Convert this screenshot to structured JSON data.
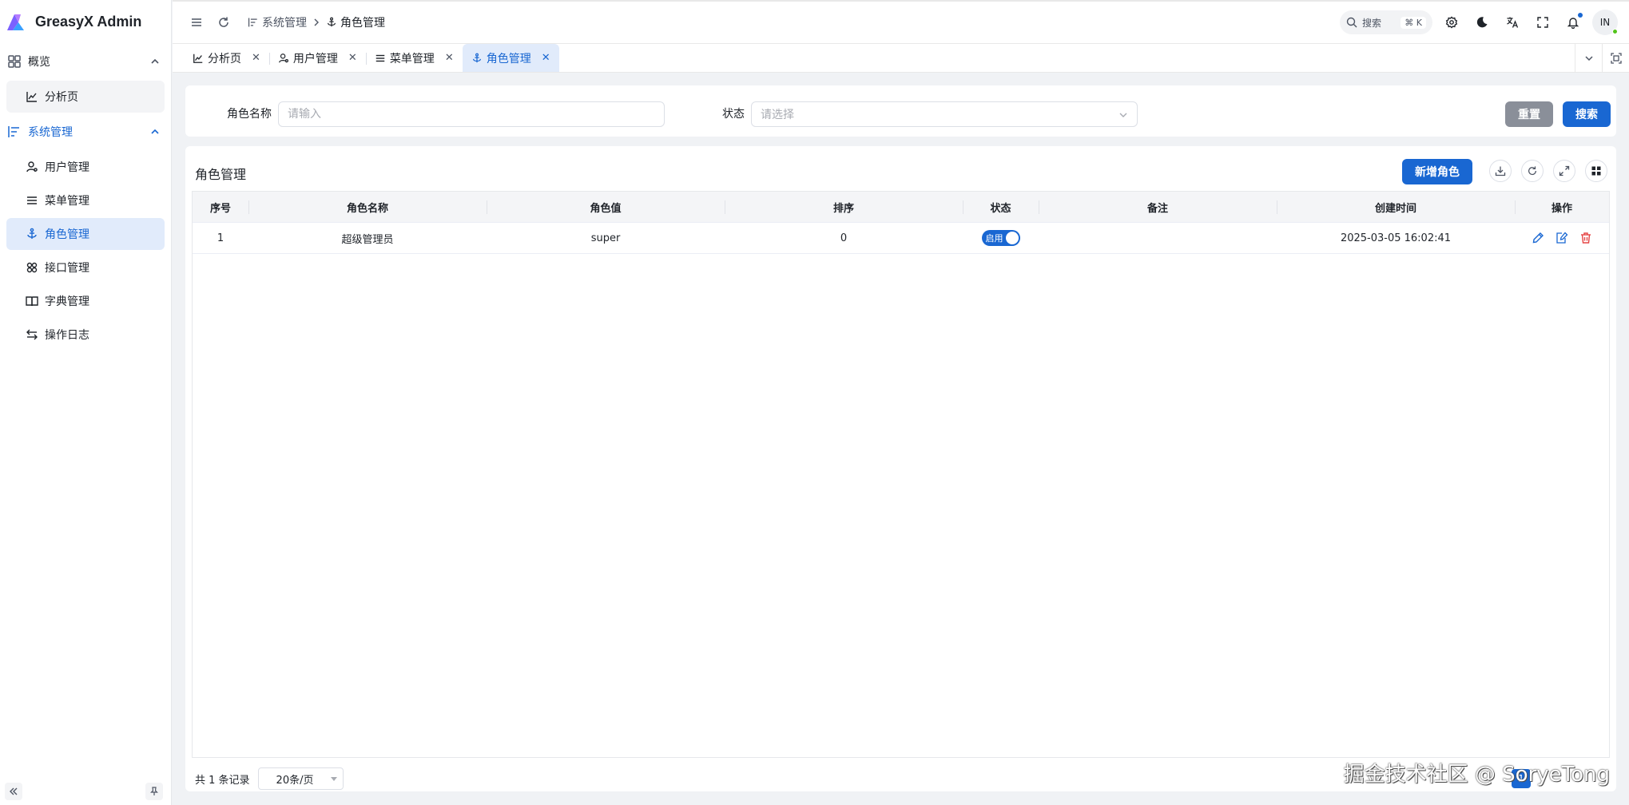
{
  "app": {
    "title": "GreasyX Admin"
  },
  "sidebar": {
    "groups": [
      {
        "label": "概览",
        "items": [
          {
            "label": "分析页"
          }
        ]
      },
      {
        "label": "系统管理",
        "items": [
          {
            "label": "用户管理"
          },
          {
            "label": "菜单管理"
          },
          {
            "label": "角色管理"
          },
          {
            "label": "接口管理"
          },
          {
            "label": "字典管理"
          },
          {
            "label": "操作日志"
          }
        ]
      }
    ]
  },
  "header": {
    "breadcrumb": [
      "系统管理",
      "角色管理"
    ],
    "search_label": "搜索",
    "search_shortcut": "⌘ K",
    "avatar_initials": "IN"
  },
  "tabs": [
    {
      "label": "分析页"
    },
    {
      "label": "用户管理"
    },
    {
      "label": "菜单管理"
    },
    {
      "label": "角色管理",
      "active": true
    }
  ],
  "filters": {
    "role_name_label": "角色名称",
    "role_name_placeholder": "请输入",
    "status_label": "状态",
    "status_placeholder": "请选择",
    "reset_label": "重置",
    "search_label": "搜索"
  },
  "table": {
    "title": "角色管理",
    "add_label": "新增角色",
    "columns": [
      "序号",
      "角色名称",
      "角色值",
      "排序",
      "状态",
      "备注",
      "创建时间",
      "操作"
    ],
    "rows": [
      {
        "index": "1",
        "name": "超级管理员",
        "value": "super",
        "order": "0",
        "status": "启用",
        "remark": "",
        "created": "2025-03-05 16:02:41"
      }
    ],
    "total_text": "共 1 条记录",
    "page_size": "20条/页",
    "current_page": "1"
  },
  "watermark": "掘金技术社区 @ SoryeTong",
  "colors": {
    "primary": "#1967d2",
    "danger": "#e54545",
    "active_bg": "#e1ebfb"
  }
}
